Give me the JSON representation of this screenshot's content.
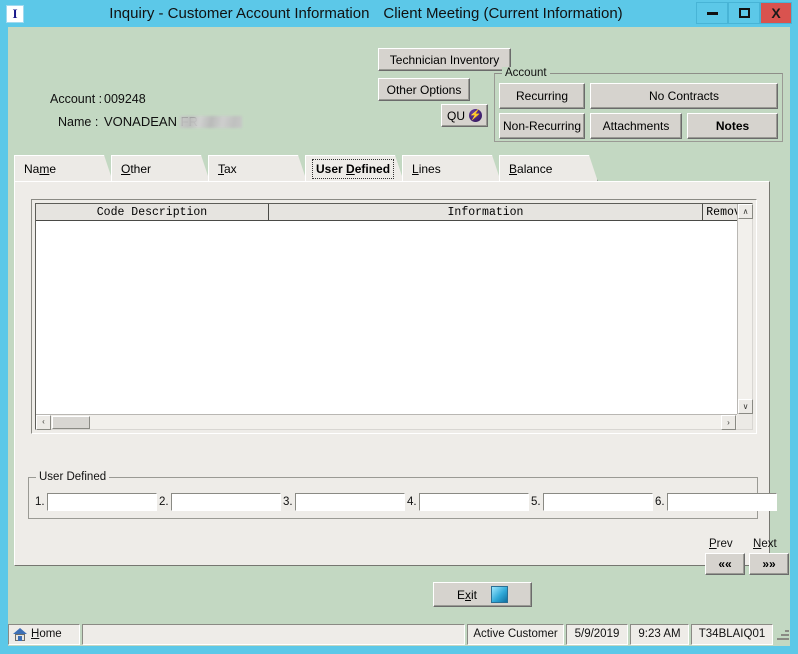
{
  "window": {
    "app_icon_glyph": "I",
    "title_main": "Inquiry - Customer Account Information",
    "title_sub": "Client Meeting  (Current Information)",
    "minimize_label": "Minimize",
    "maximize_label": "Maximize",
    "close_label": "X",
    "titlebar_color": "#5cc8e8",
    "body_color": "#c3d8c2",
    "panel_color": "#eeece8",
    "close_button_color": "#d9534f"
  },
  "account_info": {
    "account_label": "Account :",
    "account_value": "009248",
    "name_label": "Name :",
    "name_value": "VONADEAN FR",
    "name_redacted": true
  },
  "actions": {
    "technician_inventory": "Technician Inventory",
    "other_options": "Other Options",
    "qu_label": "QU",
    "qu_icon": "lightning-bolt-icon"
  },
  "account_group": {
    "legend": "Account",
    "buttons": [
      {
        "label": "Recurring",
        "bold": false
      },
      {
        "label": "No Contracts",
        "bold": false
      },
      {
        "label": "Non-Recurring",
        "bold": false
      },
      {
        "label": "Attachments",
        "bold": false
      },
      {
        "label": "Notes",
        "bold": true
      }
    ]
  },
  "tabs": [
    {
      "label": "Name",
      "pre": "Na",
      "accel": "m",
      "post": "e",
      "selected": false
    },
    {
      "label": "Other",
      "pre": "",
      "accel": "O",
      "post": "ther",
      "selected": false
    },
    {
      "label": "Tax",
      "pre": "",
      "accel": "T",
      "post": "ax",
      "selected": false
    },
    {
      "label": "User Defined",
      "pre": "User ",
      "accel": "D",
      "post": "efined",
      "selected": true
    },
    {
      "label": "Lines",
      "pre": "",
      "accel": "L",
      "post": "ines",
      "selected": false
    },
    {
      "label": "Balance",
      "pre": "",
      "accel": "B",
      "post": "alance",
      "selected": false
    }
  ],
  "grid": {
    "columns": [
      "Code Description",
      "Information",
      "Remove"
    ],
    "rows": [],
    "vertical_scroll_up": "∧",
    "vertical_scroll_down": "∨",
    "horizontal_scroll_left": "‹",
    "horizontal_scroll_right": "›"
  },
  "user_defined": {
    "legend": "User Defined",
    "fields": [
      {
        "number": "1.",
        "value": "",
        "placeholder": ""
      },
      {
        "number": "2.",
        "value": "",
        "placeholder": ""
      },
      {
        "number": "3.",
        "value": "",
        "placeholder": ""
      },
      {
        "number": "4.",
        "value": "",
        "placeholder": ""
      },
      {
        "number": "5.",
        "value": "",
        "placeholder": ""
      },
      {
        "number": "6.",
        "value": "",
        "placeholder": ""
      }
    ]
  },
  "navigation": {
    "prev_label_pre": "",
    "prev_accel": "P",
    "prev_label_post": "rev",
    "next_label_pre": "",
    "next_accel": "N",
    "next_label_post": "ext",
    "prev_button": "««",
    "next_button": "»»"
  },
  "exit": {
    "label_pre": "E",
    "accel": "x",
    "label_post": "it",
    "icon": "blue-square-icon"
  },
  "status_bar": {
    "home_label_pre": "",
    "home_accel": "H",
    "home_label_post": "ome",
    "home_icon": "house-icon",
    "message": "",
    "customer_status": "Active Customer",
    "date": "5/9/2019",
    "time": "9:23 AM",
    "terminal": "T34BLAIQ01"
  }
}
